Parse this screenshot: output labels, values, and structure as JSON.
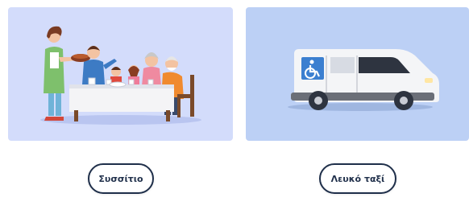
{
  "services": [
    {
      "label": "Συσσίτιο",
      "icon": "family-meal-illustration"
    },
    {
      "label": "Λευκό ταξί",
      "icon": "wheelchair-van-illustration"
    }
  ],
  "colors": {
    "card_meal_bg": "#d3dcfb",
    "card_taxi_bg": "#bcd0f5",
    "button_border": "#1f2f4a",
    "button_text": "#1f2f4a"
  }
}
